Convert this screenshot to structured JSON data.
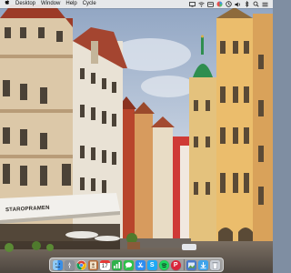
{
  "menubar": {
    "items": [
      "Desktop",
      "Window",
      "Help",
      "Cycle"
    ],
    "icons": [
      "apple-icon",
      "desktop-icon",
      "wifi-icon",
      "notification-icon",
      "color-icon",
      "clock-icon",
      "volume-icon",
      "bluetooth-icon",
      "spotlight-icon",
      "control-center-icon"
    ]
  },
  "dock": {
    "apps": [
      {
        "name": "finder-icon",
        "color": "#3a8ee6"
      },
      {
        "name": "launchpad-icon",
        "color": "#8a8f98"
      },
      {
        "name": "chrome-icon",
        "color": "#ffffff"
      },
      {
        "name": "contacts-icon",
        "color": "#b36b3a"
      },
      {
        "name": "calendar-icon",
        "color": "#ffffff",
        "text": "17"
      },
      {
        "name": "numbers-icon",
        "color": "#2fb14b"
      },
      {
        "name": "messages-icon",
        "color": "#2fc04a"
      },
      {
        "name": "app-store-icon",
        "color": "#2d8cf0"
      },
      {
        "name": "simulator-icon",
        "color": "#1ea9f5"
      },
      {
        "name": "spotify-icon",
        "color": "#1b1b1b"
      },
      {
        "name": "pinterest-icon",
        "color": "#d9263b"
      },
      {
        "name": "preview-icon",
        "color": "#4a79c8"
      },
      {
        "name": "downloads-icon",
        "color": "#3ea3ea"
      },
      {
        "name": "trash-icon",
        "color": "#c9ced6"
      }
    ]
  },
  "wallpaper": {
    "sky": "#a9b9cf",
    "left_building": "#d9c6a7",
    "right_tower": "#e6b667",
    "dome": "#2f8e4f",
    "cafe_sign": "STAROPRAMEN"
  }
}
